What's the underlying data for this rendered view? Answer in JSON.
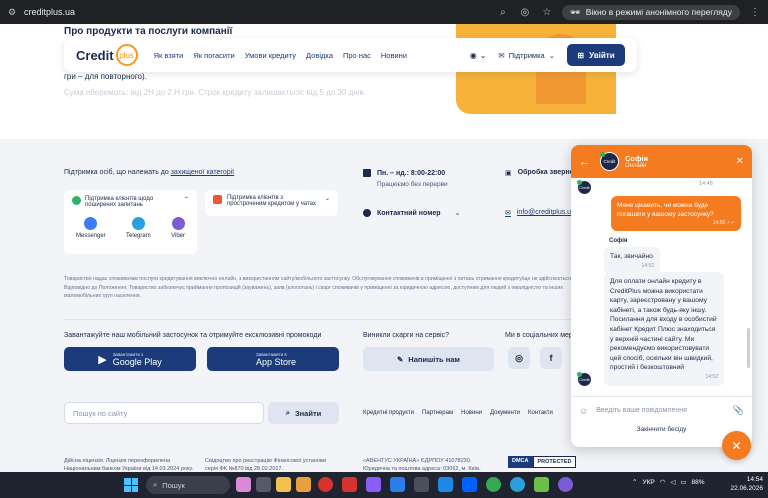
{
  "browser": {
    "url": "creditplus.ua",
    "incognito_label": "Вікно в режимі анонімного перегляду"
  },
  "hero": {
    "heading": "Про продукти та послуги компанії",
    "line": "гри – для повторного).",
    "faded_line": "Сума оберемось: від 2Н до 2 Н грн. Строк кредиту залишається: від 5 до 30 днів."
  },
  "nav": {
    "logo_text": "Credit",
    "logo_plus": "plus",
    "links": [
      "Як взяти",
      "Як погасити",
      "Умови кредиту",
      "Довідка",
      "Про нас",
      "Новини"
    ],
    "support_label": "Підтримка",
    "login_label": "Увійти"
  },
  "footer": {
    "support_title_prefix": "Підтримка осіб, що належать до ",
    "support_title_link": "захищеної категорії",
    "box1_label": "Підтримка клієнтів щодо поширених запитань",
    "apps": [
      "Messenger",
      "Telegram",
      "Viber"
    ],
    "box2_label": "Підтримка клієнтів з простроченим кредитом у чатах",
    "hours": "Пн. – нд.: 8:00-22:00",
    "hours_note": "Працюємо без перерви",
    "contact_number": "Контактний номер",
    "requests": "Обробка звернень",
    "email": "info@creditplus.ua",
    "legal": "Товариство надає споживачам послуги кредитування виключно онлайн, з використанням сайту/мобільного застосунку. Обслуговування споживачів в приміщенні з питань отримання кредиту/ще не здійснюється. Відповідно до Положення, Товариство забезпечує приймання пропозицій (зауважень), заяв (клопотань) і скарг споживачів у приміщенні за юридичною адресою, доступним для людей з інвалідністю та інших маломобільних груп населення.",
    "app_title": "Завантажуйте наш мобільний застосунок та отримуйте ексклюзивні промокоди",
    "gp_small": "Завантажити з",
    "gp_big": "Google Play",
    "as_small": "Завантажити в",
    "as_big": "App Store",
    "complaint_title": "Виникли скарги на сервіс?",
    "complaint_btn": "Напишіть нам",
    "social_title": "Ми в соціальних мережах",
    "search_placeholder": "Пошук по сайту",
    "search_btn": "Знайти",
    "links": [
      "Кредитні продукти",
      "Партнерам",
      "Новини",
      "Документи",
      "Контакти"
    ],
    "license": "Дійсна ліцензія. Ліцензія переоформлена Національним банком України від 14.03.2024 року.",
    "registration": "Свідоцтво про реєстрацію Фінансової установи серія ФК №870 від 28.02.2017.",
    "address": "«АВЕНТУС УКРАЇНА» ЄДРПОУ 41078230. Юридична та поштова адреса: 03062, м. Київ, проспект Берестейський, 90-А",
    "dmca_a": "DMCA",
    "dmca_b": "PROTECTED"
  },
  "chat": {
    "agent_name": "Софія",
    "agent_status": "Онлайн",
    "avatar_text": "Credit",
    "time0": "14:48",
    "user_msg": "Мене цікавить, чи можна буде погашати у вашому застосунку?",
    "user_time": "14:50 ✓✓",
    "sender": "Софія",
    "reply1": "Так, звичайно",
    "reply1_time": "14:52",
    "reply2": "Для оплати онлайн кредиту в CreditPlus можна використати карту, зареєстровану у вашому кабінеті, а також будь-яку іншу. Посилання для входу в особистий кабінет Кредит Плюс знаходиться у верхній частині сайту. Ми рекомендуємо використовувати цей спосіб, оскільки він швидкий, простий і безкоштовний",
    "reply2_time": "14:52",
    "input_placeholder": "Введіть ваше повідомлення",
    "end_label": "Закінчити бесіду"
  },
  "taskbar": {
    "search_label": "Пошук",
    "lang": "УКР",
    "battery": "88%",
    "time": "14:54",
    "date": "22.06.2026"
  },
  "colors": {
    "brand_orange": "#f47b20",
    "brand_navy": "#1b3b7a"
  }
}
